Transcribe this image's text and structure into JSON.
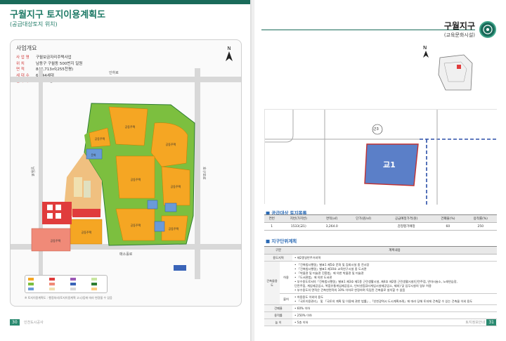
{
  "left": {
    "title": "구월지구 토지이용계획도",
    "subtitle": "(공급대상토지 위치)",
    "summary": {
      "heading": "사업개요",
      "rows": [
        {
          "key": "사 업 명",
          "value": "구월보금자리주택사업"
        },
        {
          "key": "위     치",
          "value": "남동구 구월동 500번지 일원"
        },
        {
          "key": "면     적",
          "value": "840,713㎡(255천평)"
        },
        {
          "key": "세 대 수",
          "value": "6,344세대"
        },
        {
          "key": "인 구 수",
          "value": "16,618명"
        }
      ]
    },
    "north": "N",
    "map_labels": {
      "road_north": "인하로",
      "road_east": "호구포로",
      "road_south": "매소홀로",
      "road_west": "남동로"
    },
    "blocks": [
      "공동주택",
      "공동주택",
      "공동주택",
      "공동주택",
      "공동주택",
      "공동주택",
      "공동주택",
      "공동주택",
      "공동주택",
      "공동주택",
      "공동주택",
      "근린생활시설",
      "보건복지시설",
      "문화",
      "초등학교",
      "중학교",
      "학교",
      "공원",
      "학교",
      "공동주택"
    ],
    "page_number": "30",
    "footer": "인천도시공사",
    "footnote": "※ 토지이용계획도 : 행정처리(토지이용계획 고시)등에 따라 변경될 수 있음"
  },
  "right": {
    "title": "구월지구",
    "subtitle": "(교육문화시설)",
    "north": "N",
    "parcel_label": "교1",
    "road_label": "근3",
    "page_number": "31",
    "footer": "토지정보안내",
    "section1": "공급대상 토지목록",
    "table1": {
      "headers": [
        "연번",
        "지번(가지번)",
        "면적(㎡)",
        "단가(원/㎡)",
        "공급예정가격(원)",
        "건폐율(%)",
        "용적률(%)"
      ],
      "rows": [
        [
          "1",
          "1533(교1)",
          "3,264.0",
          "",
          "감정평가예정",
          "60",
          "250"
        ]
      ]
    },
    "section2": "지구단위계획",
    "table2": {
      "headers": [
        "구분",
        "계획내용"
      ],
      "use_label": "용도지역",
      "use_value": "• 제2종일반주거지역",
      "building_label": "건축물용도",
      "allowed_label": "허용",
      "allowed": [
        "• 「건축법시행령」별표1 제5호 문화 및 집회시설 중 전시장",
        "• 「건축법시행령」별표1 제10호 교육연구시설 중 도서관",
        "• 「박물관 및 미술관 진흥법」에 의한 박물관 및 미술관",
        "• 「도서관법」에 의한 도서관",
        "• 부수용도로서의「건축법시행령」별표1 제3호 제1종 근린생활시설, 제4호 제2종 근린생활시설(단란주점, 안마시술소, 노래연습장,",
        "  단란주점, 게임제공업소, 복합유통게임제공업소, 인터넷컴퓨터게임시설제공업소, 제외) 및 업무시설의 일부 허용",
        "• 부수용도의 면적은 건축연면적의 10% 이하로 한정하며 독립된 건축물로 설치할 수 없음"
      ],
      "prohibited_label": "불허",
      "prohibited": [
        "• 허용용도 이외의 용도",
        "• 「국토이용관리」 및 「국토의 계획 및 이용에 관한 법률」,「인천광역시 도시계획조례」에 따라 당해 토지에 건축할 수 있는 건축물 이외 용도"
      ],
      "coverage_label": "건폐율",
      "coverage_value": "• 60% 이하",
      "far_label": "용적률",
      "far_value": "• 250% 이하",
      "height_label": "높   이",
      "height_value": "• 5층 이하"
    }
  },
  "colors": {
    "brand": "#1e7a66",
    "residential": "#f5a623",
    "park": "#7cbf3f",
    "school": "#6a9ad8",
    "commercial": "#e03c3c",
    "salmon": "#f08a78",
    "parcel_blue": "#5b7fc8"
  }
}
